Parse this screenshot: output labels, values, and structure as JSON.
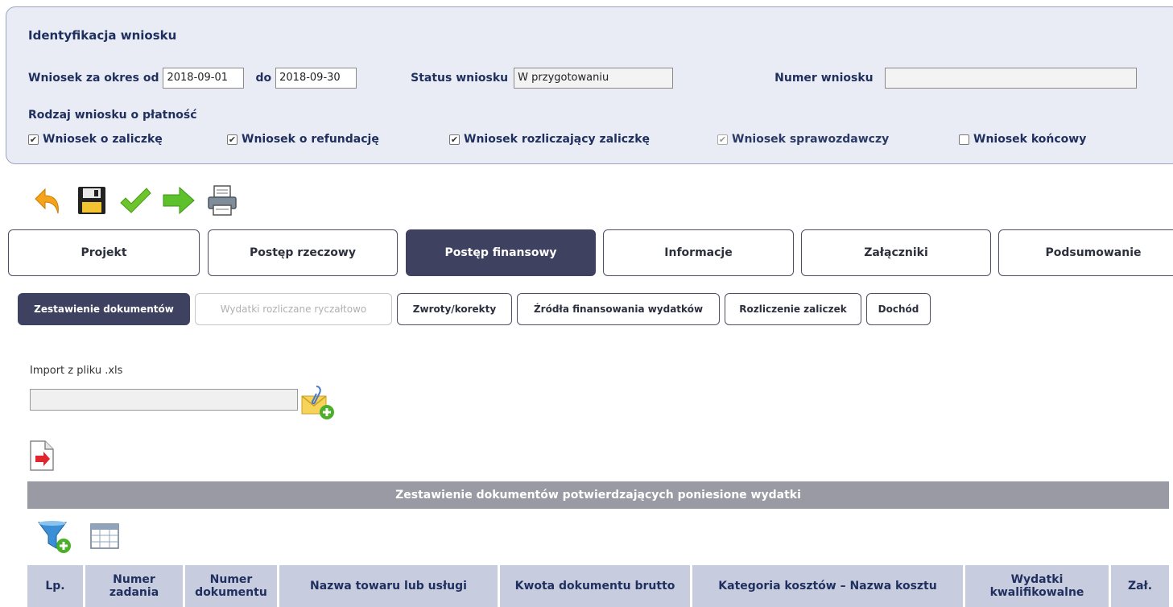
{
  "identification": {
    "title": "Identyfikacja wniosku",
    "period_from_label": "Wniosek za okres od",
    "period_from_value": "2018-09-01",
    "period_to_label": "do",
    "period_to_value": "2018-09-30",
    "status_label": "Status wniosku",
    "status_value": "W przygotowaniu",
    "number_label": "Numer wniosku",
    "number_value": "",
    "type_label": "Rodzaj wniosku o płatność",
    "types": [
      {
        "label": "Wniosek o zaliczkę",
        "checked": true,
        "disabled": false
      },
      {
        "label": "Wniosek o refundację",
        "checked": true,
        "disabled": false
      },
      {
        "label": "Wniosek rozliczający zaliczkę",
        "checked": true,
        "disabled": false
      },
      {
        "label": "Wniosek sprawozdawczy",
        "checked": true,
        "disabled": true
      },
      {
        "label": "Wniosek końcowy",
        "checked": false,
        "disabled": false
      }
    ]
  },
  "toolbar": {
    "icons": [
      "back-arrow-icon",
      "save-disk-icon",
      "check-icon",
      "forward-arrow-icon",
      "print-icon"
    ]
  },
  "tabs": [
    {
      "label": "Projekt",
      "active": false
    },
    {
      "label": "Postęp rzeczowy",
      "active": false
    },
    {
      "label": "Postęp finansowy",
      "active": true
    },
    {
      "label": "Informacje",
      "active": false
    },
    {
      "label": "Załączniki",
      "active": false
    },
    {
      "label": "Podsumowanie",
      "active": false
    }
  ],
  "subtabs": [
    {
      "label": "Zestawienie dokumentów",
      "state": "active"
    },
    {
      "label": "Wydatki rozliczane ryczałtowo",
      "state": "disabled"
    },
    {
      "label": "Zwroty/korekty",
      "state": "normal"
    },
    {
      "label": "Źródła finansowania wydatków",
      "state": "normal"
    },
    {
      "label": "Rozliczenie zaliczek",
      "state": "normal"
    },
    {
      "label": "Dochód",
      "state": "normal"
    }
  ],
  "import": {
    "label": "Import z pliku .xls",
    "value": ""
  },
  "table": {
    "title": "Zestawienie dokumentów potwierdzających poniesione wydatki",
    "columns": [
      "Lp.",
      "Numer zadania",
      "Numer dokumentu",
      "Nazwa towaru lub usługi",
      "Kwota dokumentu brutto",
      "Kategoria kosztów – Nazwa kosztu",
      "Wydatki kwalifikowalne",
      "Zał."
    ]
  },
  "colors": {
    "accent_dark": "#3e4160",
    "panel_bg": "#e9ecf4",
    "table_header_bg": "#999aa3",
    "column_header_bg": "#c8ccdf"
  }
}
